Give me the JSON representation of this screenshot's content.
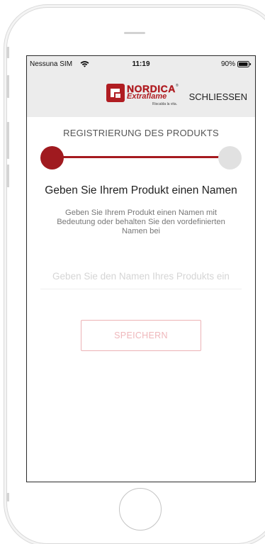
{
  "statusbar": {
    "carrier": "Nessuna SIM",
    "time": "11:19",
    "battery": "90%",
    "wifi_icon": "wifi-icon",
    "battery_icon": "battery-icon"
  },
  "navbar": {
    "logo": {
      "brand_top": "NORDICA",
      "brand_reg": "®",
      "brand_bottom": "Extraflame",
      "tagline": "Riscalda la vita."
    },
    "close_label": "SCHLIESSEN"
  },
  "content": {
    "step_title": "REGISTRIERUNG DES PRODUKTS",
    "progress": {
      "current_step": 1,
      "total_steps": 2
    },
    "heading": "Geben Sie Ihrem Produkt einen Namen",
    "description": "Geben Sie Ihrem Produkt einen Namen mit Bedeutung oder behalten Sie den vordefinierten Namen bei",
    "name_input": {
      "value": "",
      "placeholder": "Geben Sie den Namen Ihres Produkts ein"
    },
    "save_label": "SPEICHERN"
  },
  "colors": {
    "brand_red": "#a01a1f",
    "save_disabled": "#efb7bb",
    "inactive_step": "#e1e1e1",
    "bar_background": "#ececec"
  }
}
